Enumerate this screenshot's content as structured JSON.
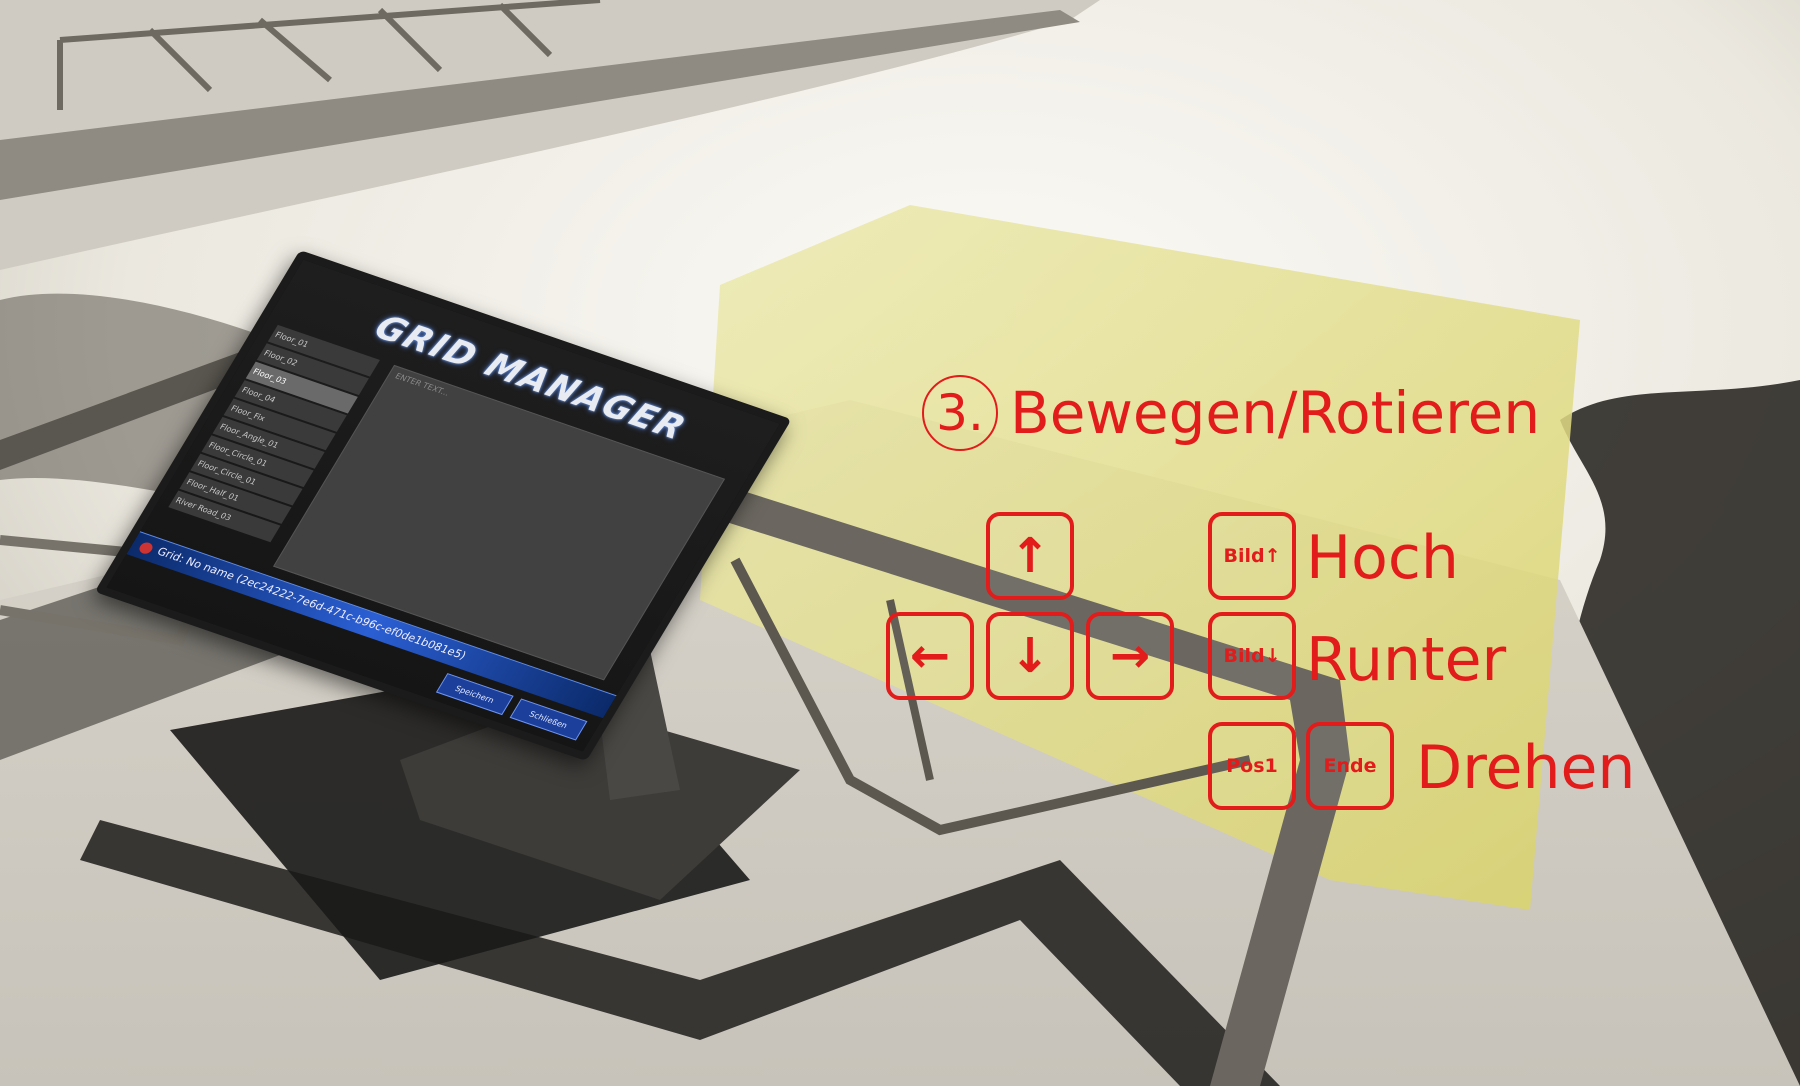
{
  "monitor": {
    "logo": "GRID MANAGER",
    "list_items": [
      "Floor_01",
      "Floor_02",
      "Floor_03",
      "Floor_04",
      "Floor_Fix",
      "Floor_Angle_01",
      "Floor_Circle_01",
      "Floor_Circle_01",
      "Floor_Half_01",
      "River Road_03"
    ],
    "selected_index": 2,
    "preview_label": "ENTER TEXT...",
    "grid_name": "Grid: No name (2ec24222-7e6d-471c-b96c-ef0de1b081e5)",
    "apply_button": "Speichern",
    "close_button": "Schließen"
  },
  "overlay": {
    "step_number": "3.",
    "step_title": "Bewegen/Rotieren",
    "arrow_keys": {
      "up": "↑",
      "left": "←",
      "down": "↓",
      "right": "→"
    },
    "rows": [
      {
        "keys": [
          "Bild↑"
        ],
        "label": "Hoch"
      },
      {
        "keys": [
          "Bild↓"
        ],
        "label": "Runter"
      },
      {
        "keys": [
          "Pos1",
          "Ende"
        ],
        "label": "Drehen"
      }
    ],
    "accent_color": "#e21b1b"
  }
}
